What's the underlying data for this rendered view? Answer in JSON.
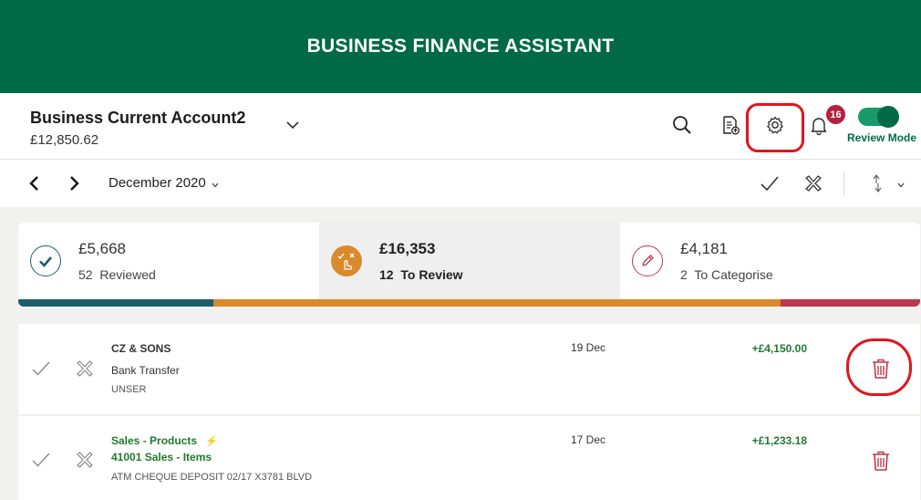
{
  "app": {
    "title": "BUSINESS FINANCE ASSISTANT"
  },
  "account": {
    "name": "Business Current Account2",
    "balance": "£12,850.62",
    "notifications_count": "16",
    "review_mode_label": "Review Mode",
    "review_mode_on": true
  },
  "toolbar": {
    "icons": [
      "search-icon",
      "export-document-icon",
      "gear-icon",
      "bell-icon"
    ]
  },
  "period": {
    "label": "December 2020"
  },
  "summary": {
    "reviewed": {
      "amount": "£5,668",
      "count": "52",
      "label": "Reviewed"
    },
    "to_review": {
      "amount": "£16,353",
      "count": "12",
      "label": "To Review"
    },
    "to_categorise": {
      "amount": "£4,181",
      "count": "2",
      "label": "To Categorise"
    },
    "progress_share": {
      "reviewed": 0.216,
      "to_review": 0.629,
      "to_categorise": 0.155
    }
  },
  "transactions": [
    {
      "payee": "CZ & SONS",
      "category": "Bank Transfer",
      "description": "UNSER",
      "date": "19 Dec",
      "amount": "+£4,150.00"
    },
    {
      "payee": "Sales - Products",
      "category": "41001 Sales - Items",
      "description": "ATM CHEQUE DEPOSIT 02/17 X3781 BLVD",
      "date": "17 Dec",
      "amount": "+£1,233.18"
    }
  ],
  "colors": {
    "brand_green": "#006a47",
    "reviewed_teal": "#1b5e6e",
    "review_orange": "#d98a2b",
    "categorise_red": "#b83a4b",
    "highlight_red": "#e0151b",
    "amount_green": "#1f7a2e"
  }
}
